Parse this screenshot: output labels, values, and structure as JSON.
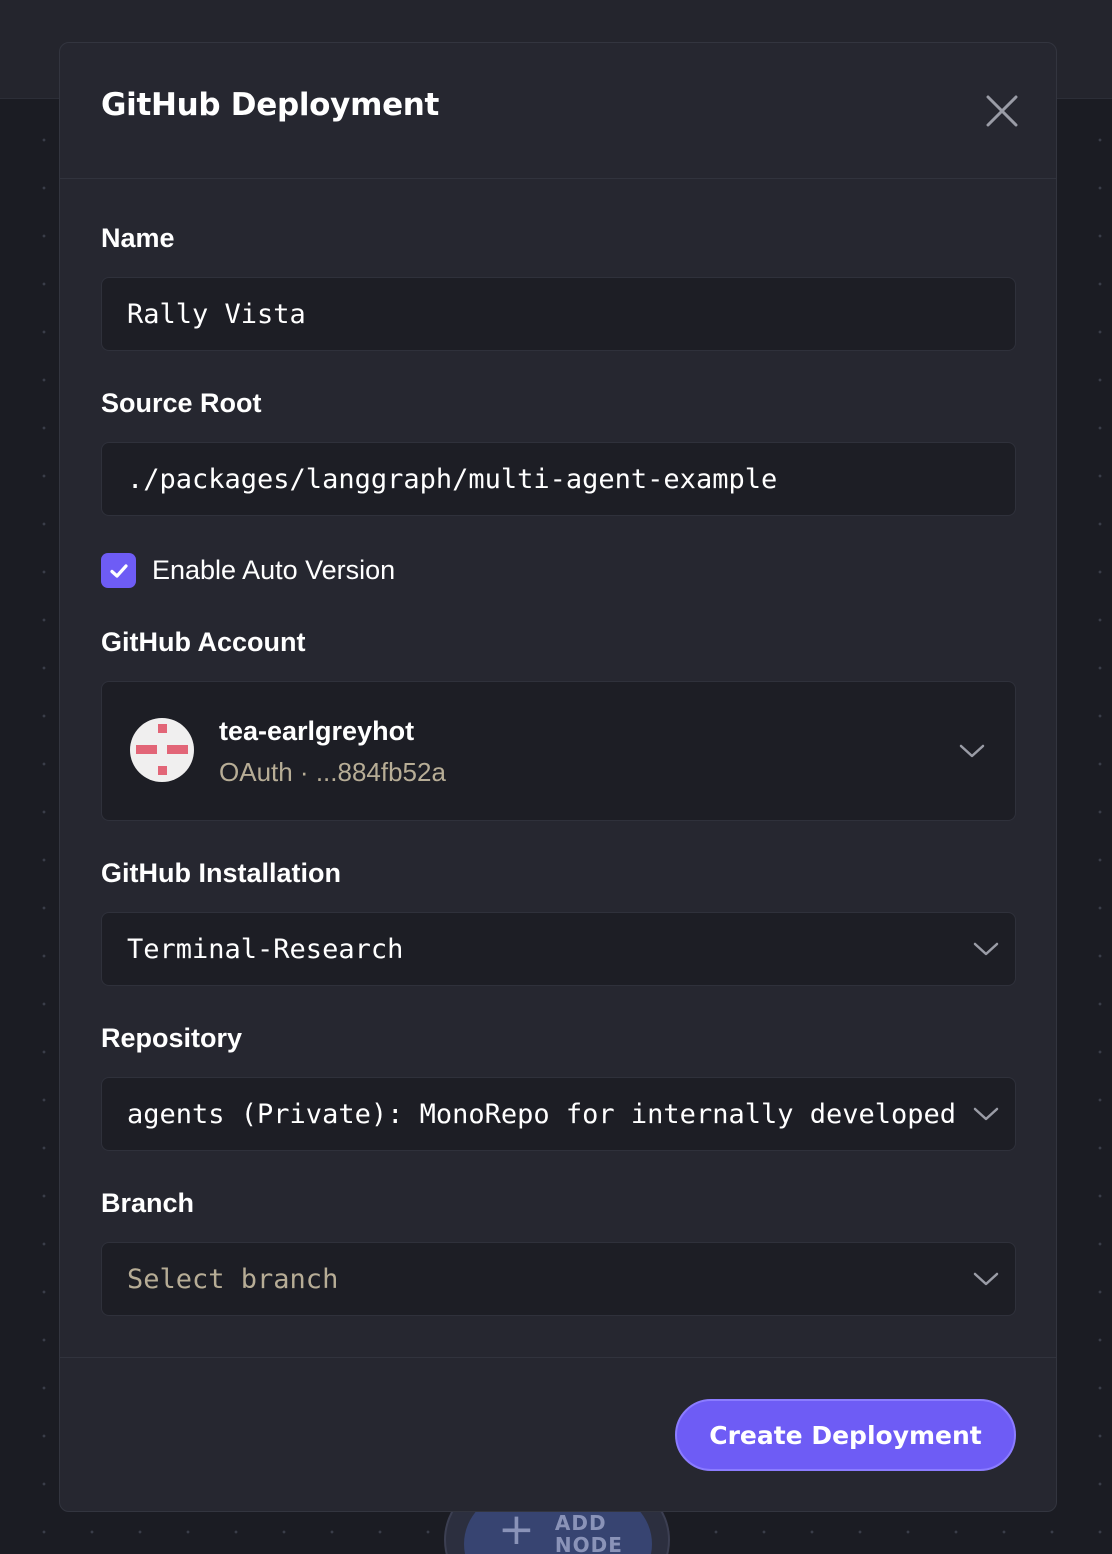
{
  "background": {
    "add_node": {
      "label_line1": "ADD",
      "label_line2": "NODE",
      "icon": "plus-icon"
    }
  },
  "modal": {
    "title": "GitHub Deployment",
    "close_icon": "close-icon",
    "name": {
      "label": "Name",
      "value": "Rally Vista"
    },
    "source_root": {
      "label": "Source Root",
      "value": "./packages/langgraph/multi-agent-example"
    },
    "auto_version": {
      "label": "Enable Auto Version",
      "checked": true
    },
    "github_account": {
      "label": "GitHub Account",
      "name": "tea-earlgreyhot",
      "meta": "OAuth · ...884fb52a"
    },
    "github_installation": {
      "label": "GitHub Installation",
      "value": "Terminal-Research"
    },
    "repository": {
      "label": "Repository",
      "value": "agents (Private): MonoRepo for internally developed"
    },
    "branch": {
      "label": "Branch",
      "placeholder": "Select branch"
    },
    "submit_label": "Create Deployment"
  },
  "colors": {
    "accent": "#6e5cf5",
    "modal_bg": "#262730",
    "input_bg": "#1d1e25",
    "muted_text": "#b7ad96",
    "avatar_red": "#e26577"
  }
}
